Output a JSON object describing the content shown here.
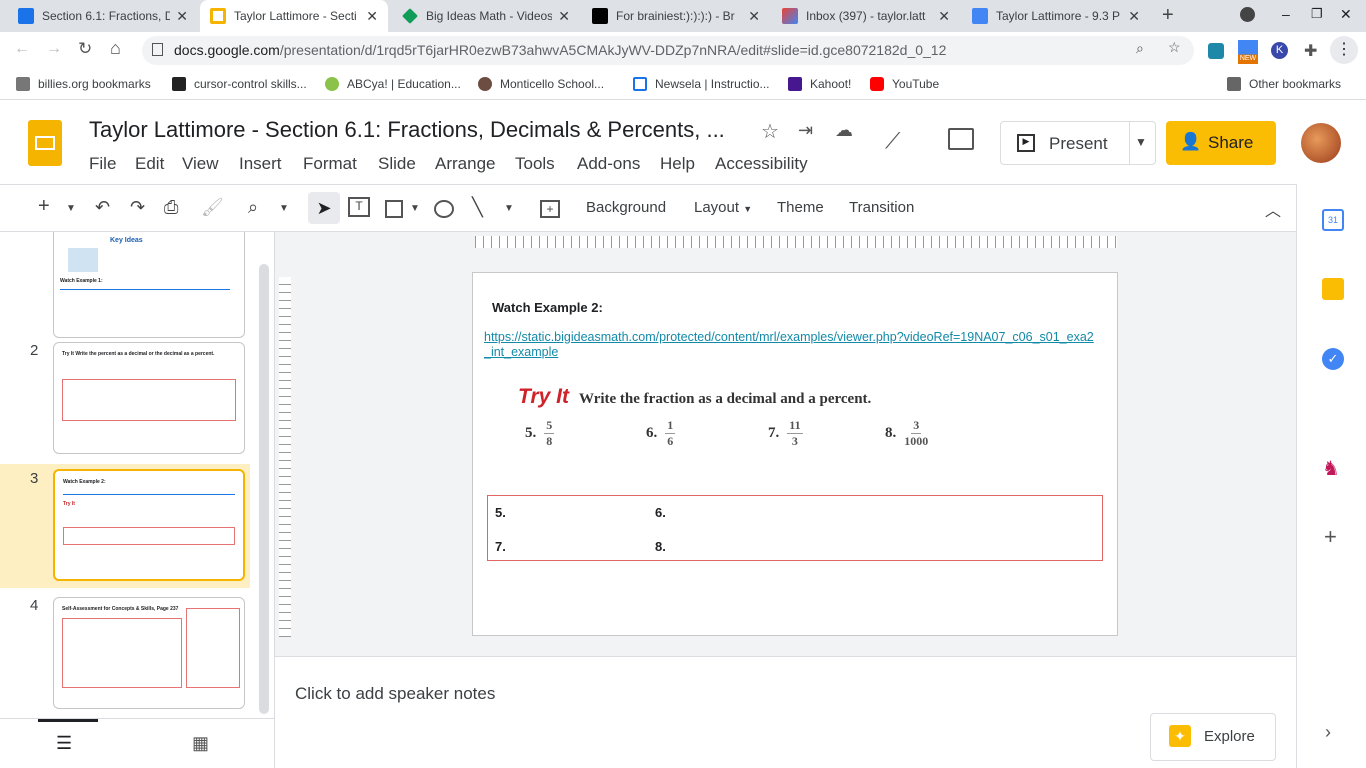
{
  "browser": {
    "tabs": [
      {
        "title": "Section 6.1: Fractions, D",
        "color": "#1a73e8"
      },
      {
        "title": "Taylor Lattimore - Secti",
        "color": "#f4b400"
      },
      {
        "title": "Big Ideas Math - Videos",
        "color": "#0f9d58"
      },
      {
        "title": "For brainiest:):):):) - Br",
        "color": "#000000"
      },
      {
        "title": "Inbox (397) - taylor.latt",
        "color": "#ea4335"
      },
      {
        "title": "Taylor Lattimore - 9.3 P",
        "color": "#4285f4"
      }
    ],
    "url_host": "docs.google.com",
    "url_path": "/presentation/d/1rqd5rT6jarHR0ezwB73ahwvA5CMAkJyWV-DDZp7nNRA/edit#slide=id.gce8072182d_0_12",
    "bookmarks": [
      "billies.org bookmarks",
      "cursor-control skills...",
      "ABCya! | Education...",
      "Monticello School...",
      "Newsela | Instructio...",
      "Kahoot!",
      "YouTube"
    ],
    "other_bookmarks": "Other bookmarks",
    "new_badge": "NEW"
  },
  "doc": {
    "title": "Taylor Lattimore - Section 6.1: Fractions, Decimals & Percents, ...",
    "menu": [
      "File",
      "Edit",
      "View",
      "Insert",
      "Format",
      "Slide",
      "Arrange",
      "Tools",
      "Add-ons",
      "Help",
      "Accessibility"
    ],
    "present": "Present",
    "share": "Share"
  },
  "toolbar": {
    "background": "Background",
    "layout": "Layout",
    "theme": "Theme",
    "transition": "Transition"
  },
  "filmstrip": {
    "slides": [
      {
        "num": "2",
        "title": "Try It  Write the percent as a decimal or the decimal as a percent."
      },
      {
        "num": "3",
        "title": "Watch Example 2:"
      },
      {
        "num": "4",
        "title": "Self-Assessment for Concepts & Skills, Page 237"
      }
    ],
    "prev_title": "Key Ideas",
    "prev_caption": "Watch Example 1:"
  },
  "slide": {
    "heading": "Watch Example 2:",
    "link": "https://static.bigideasmath.com/protected/content/mrl/examples/viewer.php?videoRef=19NA07_c06_s01_exa2_int_example",
    "try_it": "Try It",
    "instruction": "Write the fraction as a decimal and a percent.",
    "problems": [
      {
        "n": "5.",
        "num": "5",
        "den": "8"
      },
      {
        "n": "6.",
        "num": "1",
        "den": "6"
      },
      {
        "n": "7.",
        "num": "11",
        "den": "3"
      },
      {
        "n": "8.",
        "num": "3",
        "den": "1000"
      }
    ],
    "answers": [
      "5.",
      "6.",
      "7.",
      "8."
    ]
  },
  "notes": "Click to add speaker notes",
  "explore": "Explore"
}
